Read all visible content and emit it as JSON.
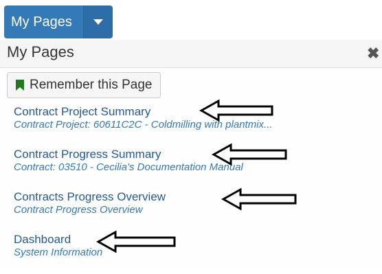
{
  "menu_button": {
    "label": "My Pages",
    "caret_icon": "caret-down-icon"
  },
  "panel": {
    "title": "My Pages",
    "close_icon": "close-icon",
    "remember_button": {
      "label": "Remember this Page",
      "icon": "bookmark-icon",
      "icon_color": "#1f7a1f"
    },
    "items": [
      {
        "title": "Contract Project Summary",
        "subtitle": "Contract Project: 60611C2C - Coldmilling with plantmix..."
      },
      {
        "title": "Contract Progress Summary",
        "subtitle": "Contract: 03510 - Cecilia's Documentation Manual"
      },
      {
        "title": "Contracts Progress Overview",
        "subtitle": "Contract Progress Overview"
      },
      {
        "title": "Dashboard",
        "subtitle": "System Information"
      }
    ]
  },
  "annotation": {
    "arrow_icon": "left-arrow-icon"
  }
}
